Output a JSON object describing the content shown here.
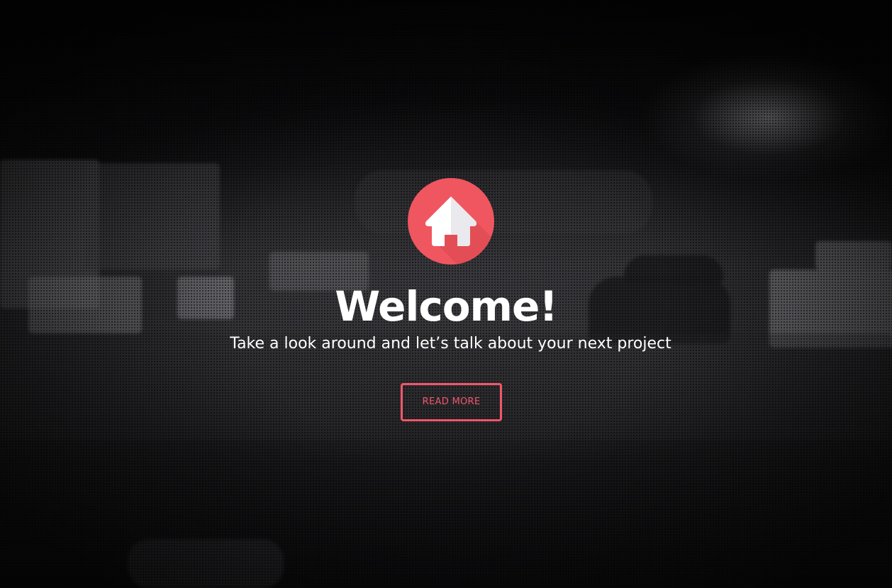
{
  "hero": {
    "logo_icon": "home-icon",
    "title": "Welcome!",
    "subtitle": "Take a look around and let’s talk about your next project",
    "cta_label": "READ MORE"
  },
  "colors": {
    "accent": "#f0565f",
    "button_border": "#f0566b",
    "text": "#ffffff",
    "background": "#0b0b0d"
  }
}
